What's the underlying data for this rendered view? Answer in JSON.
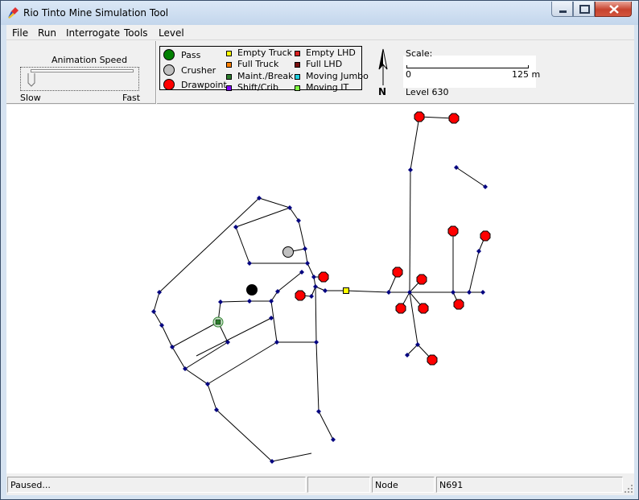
{
  "window": {
    "title": "Rio Tinto Mine Simulation Tool"
  },
  "menu": {
    "file": "File",
    "run": "Run",
    "interrogate": "Interrogate",
    "tools": "Tools",
    "level": "Level"
  },
  "speed": {
    "caption": "Animation Speed",
    "slow": "Slow",
    "fast": "Fast",
    "value": 0.05
  },
  "legend": {
    "pass": "Pass",
    "crusher": "Crusher",
    "drawpoint": "Drawpoint",
    "empty_truck": "Empty Truck",
    "full_truck": "Full Truck",
    "maint_break": "Maint./Break",
    "shift_crib": "Shift/Crib",
    "empty_lhd": "Empty LHD",
    "full_lhd": "Full LHD",
    "moving_jumbo": "Moving Jumbo",
    "moving_it": "Moving IT"
  },
  "colors": {
    "pass": "#008000",
    "crusher": "#c0c0c0",
    "drawpoint": "#ff0000",
    "empty_truck": "#ffff00",
    "full_truck": "#ff8000",
    "maint_break": "#2d7d2d",
    "shift_crib": "#8000ff",
    "empty_lhd": "#d82020",
    "full_lhd": "#7a1010",
    "moving_jumbo": "#20d0e0",
    "moving_it": "#80ff40",
    "node": "#000080"
  },
  "compass": {
    "north": "N"
  },
  "scale": {
    "caption": "Scale:",
    "start": "0",
    "end": "125 m"
  },
  "level": {
    "label": "Level  630"
  },
  "status": {
    "message": "Paused...",
    "extra": "",
    "kind": "Node",
    "id": "N691"
  }
}
